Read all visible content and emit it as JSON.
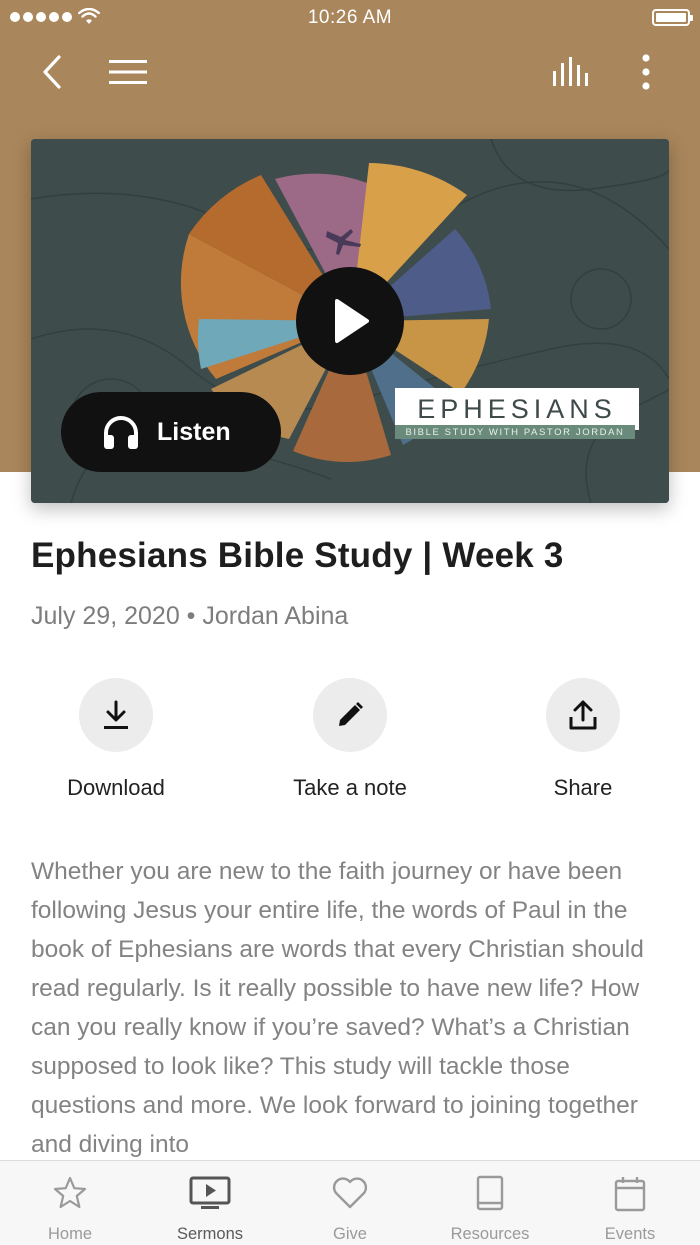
{
  "status_bar": {
    "time": "10:26 AM"
  },
  "colors": {
    "header": "#a9865b",
    "accent_dark": "#111111"
  },
  "nav": {
    "back_icon": "chevron-left-icon",
    "menu_icon": "hamburger-menu-icon",
    "equalizer_icon": "equalizer-icon",
    "more_icon": "more-vertical-icon"
  },
  "media": {
    "listen_label": "Listen",
    "art_title": "EPHESIANS",
    "art_subtitle": "BIBLE STUDY WITH PASTOR JORDAN"
  },
  "sermon": {
    "title": "Ephesians Bible Study | Week 3",
    "meta": "July 29, 2020 • Jordan Abina",
    "description": "Whether you are new to the faith journey or have been following Jesus your entire life, the words of Paul in the book of Ephesians are words that every Christian should read regularly. Is it really possible to have new life? How can you really know if you’re saved? What’s a Christian supposed to look like? This study will tackle those questions and more. We look forward to joining together and diving into"
  },
  "actions": [
    {
      "label": "Download",
      "icon": "download-icon"
    },
    {
      "label": "Take a note",
      "icon": "pencil-icon"
    },
    {
      "label": "Share",
      "icon": "share-icon"
    }
  ],
  "tabs": [
    {
      "label": "Home",
      "icon": "star-icon"
    },
    {
      "label": "Sermons",
      "icon": "tv-play-icon",
      "active": true
    },
    {
      "label": "Give",
      "icon": "heart-icon"
    },
    {
      "label": "Resources",
      "icon": "book-icon"
    },
    {
      "label": "Events",
      "icon": "calendar-icon"
    }
  ]
}
